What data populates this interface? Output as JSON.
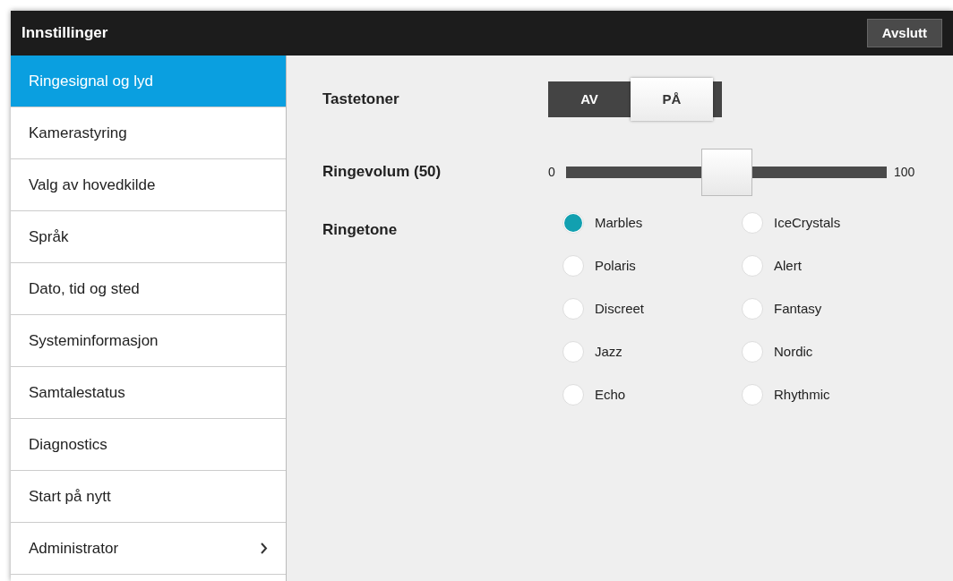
{
  "header": {
    "title": "Innstillinger",
    "exit_button": "Avslutt"
  },
  "sidebar": {
    "items": [
      {
        "label": "Ringesignal og lyd",
        "selected": true
      },
      {
        "label": "Kamerastyring",
        "selected": false
      },
      {
        "label": "Valg av hovedkilde",
        "selected": false
      },
      {
        "label": "Språk",
        "selected": false
      },
      {
        "label": "Dato, tid og sted",
        "selected": false
      },
      {
        "label": "Systeminformasjon",
        "selected": false
      },
      {
        "label": "Samtalestatus",
        "selected": false
      },
      {
        "label": "Diagnostics",
        "selected": false
      },
      {
        "label": "Start på nytt",
        "selected": false
      },
      {
        "label": "Administrator",
        "selected": false,
        "has_submenu": true
      }
    ]
  },
  "settings": {
    "key_tones": {
      "label": "Tastetoner",
      "options": [
        {
          "label": "AV",
          "selected": false
        },
        {
          "label": "PÅ",
          "selected": true
        }
      ]
    },
    "ring_volume": {
      "label": "Ringevolum (50)",
      "min": "0",
      "max": "100",
      "level": 0.5
    },
    "ringtone": {
      "label": "Ringetone",
      "options": [
        {
          "label": "Marbles",
          "selected": true
        },
        {
          "label": "IceCrystals",
          "selected": false
        },
        {
          "label": "Polaris",
          "selected": false
        },
        {
          "label": "Alert",
          "selected": false
        },
        {
          "label": "Discreet",
          "selected": false
        },
        {
          "label": "Fantasy",
          "selected": false
        },
        {
          "label": "Jazz",
          "selected": false
        },
        {
          "label": "Nordic",
          "selected": false
        },
        {
          "label": "Echo",
          "selected": false
        },
        {
          "label": "Rhythmic",
          "selected": false
        }
      ]
    }
  }
}
